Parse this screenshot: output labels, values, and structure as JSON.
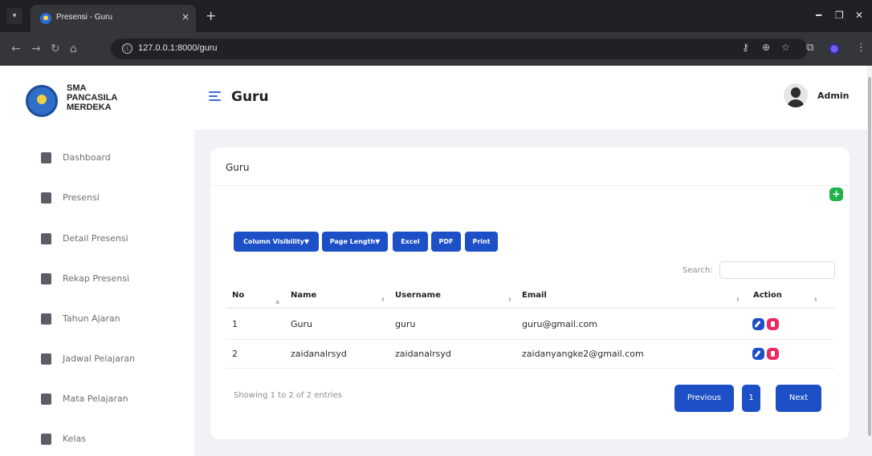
{
  "browser": {
    "tab_title": "Presensi - Guru",
    "tab_close": "×",
    "new_tab": "+",
    "url": "127.0.0.1:8000/guru",
    "info_glyph": "ⓘ",
    "icons": [
      "tab-menu-icon",
      "back-icon",
      "forward-icon",
      "reload-icon",
      "home-icon",
      "key-icon",
      "zoom-icon",
      "star-icon",
      "extensions-icon",
      "profile-icon",
      "menu-icon"
    ]
  },
  "sidebar": {
    "brand": "SMA PANCASILA MERDEKA",
    "items": [
      {
        "label": "Dashboard",
        "icon": "dashboard-icon"
      },
      {
        "label": "Presensi",
        "icon": "calendar-check-icon"
      },
      {
        "label": "Detail Presensi",
        "icon": "calendar-check-icon"
      },
      {
        "label": "Rekap Presensi",
        "icon": "database-icon"
      },
      {
        "label": "Tahun Ajaran",
        "icon": "calendar-icon"
      },
      {
        "label": "Jadwal Pelajaran",
        "icon": "calendar-grid-icon"
      },
      {
        "label": "Mata Pelajaran",
        "icon": "book-icon"
      },
      {
        "label": "Kelas",
        "icon": "building-icon"
      }
    ]
  },
  "header": {
    "title": "Guru",
    "user_name": "Admin"
  },
  "card": {
    "title": "Guru",
    "add_button": "+",
    "buttons": {
      "column_visibility": "Column Visibility▼",
      "page_length": "Page Length▼",
      "excel": "Excel",
      "pdf": "PDF",
      "print": "Print"
    },
    "search_label": "Search:",
    "search_value": "",
    "table": {
      "columns": [
        "No",
        "Name",
        "Username",
        "Email",
        "Action"
      ],
      "rows": [
        {
          "no": "1",
          "name": "Guru",
          "username": "guru",
          "email": "guru@gmail.com"
        },
        {
          "no": "2",
          "name": "zaidanalrsyd",
          "username": "zaidanalrsyd",
          "email": "zaidanyangke2@gmail.com"
        }
      ]
    },
    "info": "Showing 1 to 2 of 2 entries",
    "pagination": {
      "previous": "Previous",
      "page": "1",
      "next": "Next"
    }
  },
  "colors": {
    "primary": "#1d4fc7",
    "success": "#22b14c",
    "danger": "#ea2a61",
    "background": "#f1f2f5"
  }
}
